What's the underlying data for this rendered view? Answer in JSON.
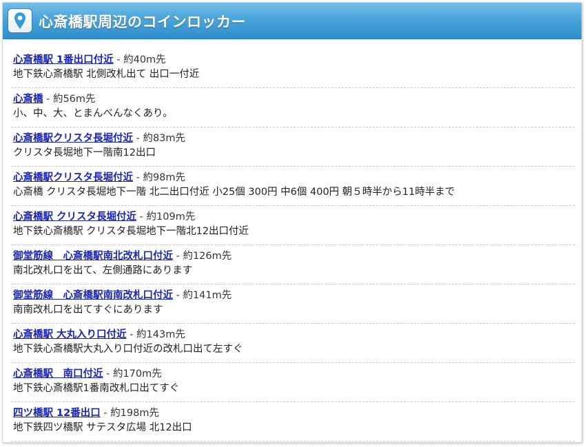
{
  "header": {
    "title": "心斎橋駅周辺のコインロッカー",
    "icon": "map-pin-icon",
    "colors": {
      "bar_top": "#73bde8",
      "bar_bottom": "#2f8ecb",
      "link": "#1a24b5"
    }
  },
  "separator": " - ",
  "items": [
    {
      "name": "心斎橋駅 1番出口付近",
      "distance": "約40m先",
      "description": "地下鉄心斎橋駅 北側改札出て 出口一付近"
    },
    {
      "name": "心斎橋",
      "distance": "約56m先",
      "description": "小、中、大、とまんべんなくあり。"
    },
    {
      "name": "心斎橋駅クリスタ長堀付近",
      "distance": "約83m先",
      "description": "クリスタ長堀地下一階南12出口"
    },
    {
      "name": "心斎橋駅クリスタ長堀付近",
      "distance": "約98m先",
      "description": "心斎橋 クリスタ長堀地下一階 北二出口付近 小25個 300円 中6個 400円 朝５時半から11時半まで"
    },
    {
      "name": "心斎橋駅 クリスタ長堀付近",
      "distance": "約109m先",
      "description": "地下鉄心斎橋駅 クリスタ長堀地下一階北12出口付近"
    },
    {
      "name": "御堂筋線　心斎橋駅南北改札口付近",
      "distance": "約126m先",
      "description": "南北改札口を出て、左側通路にあります"
    },
    {
      "name": "御堂筋線　心斎橋駅南南改札口付近",
      "distance": "約141m先",
      "description": "南南改札口を出てすぐにあります"
    },
    {
      "name": "心斎橋駅 大丸入り口付近",
      "distance": "約143m先",
      "description": "地下鉄心斎橋駅大丸入り口付近の改札口出て左すぐ"
    },
    {
      "name": "心斎橋駅　南口付近",
      "distance": "約170m先",
      "description": "地下鉄心斎橋駅1番南改札口出てすぐ"
    },
    {
      "name": "四ツ橋駅 12番出口",
      "distance": "約198m先",
      "description": "地下鉄四ツ橋駅 サテスタ広場 北12出口"
    }
  ]
}
